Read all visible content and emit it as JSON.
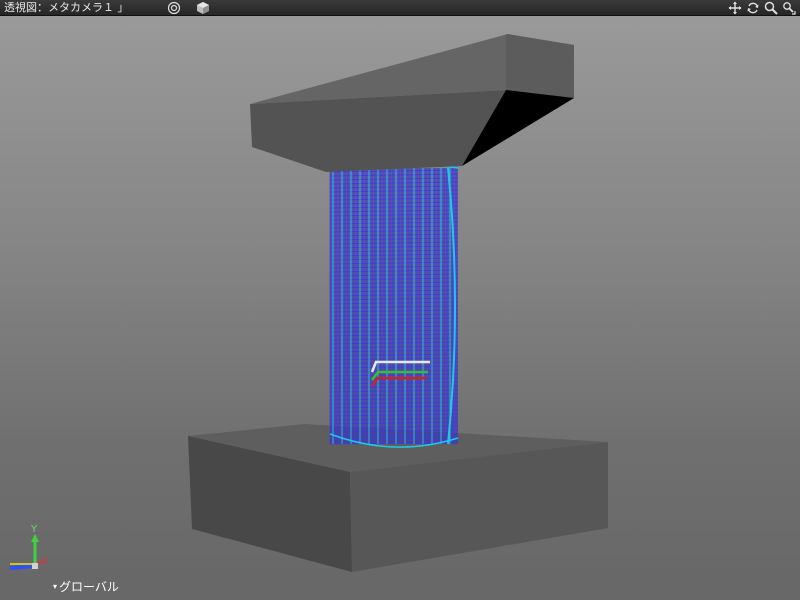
{
  "viewport": {
    "title": "透視図：メタカメラ１ 」",
    "icons": {
      "display_mode": "target-circle-icon",
      "shading": "cube-icon",
      "pan": "move-arrows-icon",
      "rotate": "rotate-icon",
      "zoom": "magnifier-icon",
      "fit": "dolly-zoom-icon"
    },
    "coord_mode": {
      "arrow": "▾",
      "label": "グローバル"
    },
    "axis_triad": {
      "y": "Y",
      "x": "X"
    }
  },
  "colors": {
    "toolbar_bg": "#2e2e2e",
    "concrete_top": "#5e5e5e",
    "concrete_side": "#545454",
    "rebar_blue": "#3a3adf",
    "rebar_cyan": "#20c8e8",
    "axis_y": "#3fd13f",
    "axis_x": "#e03030",
    "axis_z": "#3050ff"
  }
}
